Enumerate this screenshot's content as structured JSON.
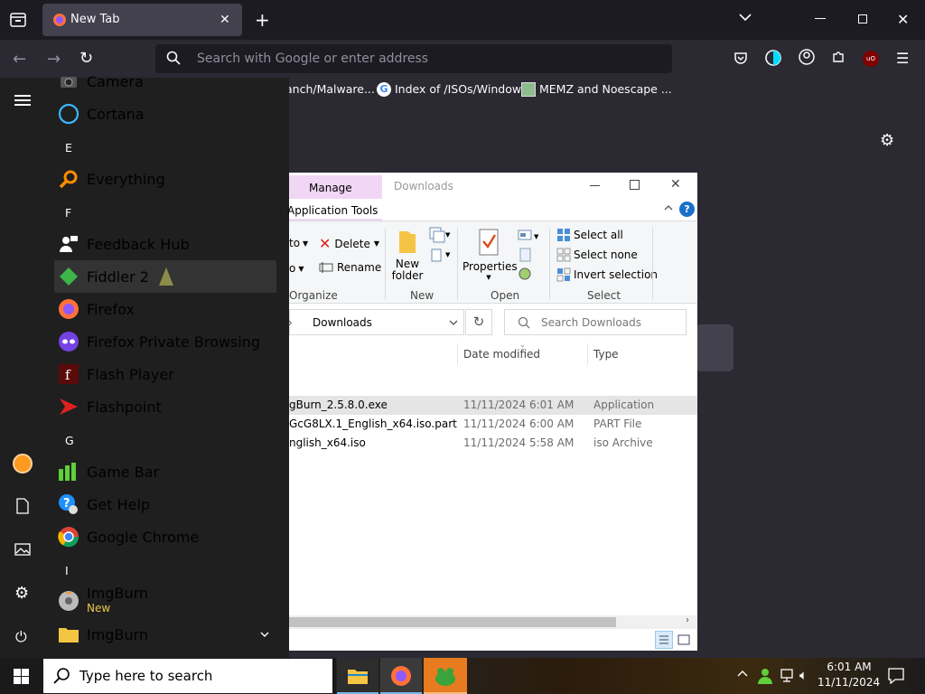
{
  "browser": {
    "tab_title": "New Tab",
    "address_placeholder": "Search with Google or enter address",
    "bookmarks": [
      "anch/Malware...",
      "Index of /ISOs/Windows",
      "MEMZ and Noescape ..."
    ]
  },
  "start_menu": {
    "apps": [
      {
        "label": "Camera"
      },
      {
        "label": "Cortana"
      },
      {
        "label": "Everything"
      },
      {
        "label": "Feedback Hub"
      },
      {
        "label": "Fiddler 2"
      },
      {
        "label": "Firefox"
      },
      {
        "label": "Firefox Private Browsing"
      },
      {
        "label": "Flash Player"
      },
      {
        "label": "Flashpoint"
      },
      {
        "label": "Game Bar"
      },
      {
        "label": "Get Help"
      },
      {
        "label": "Google Chrome"
      },
      {
        "label": "ImgBurn",
        "badge": "New"
      },
      {
        "label": "ImgBurn"
      }
    ],
    "letters": [
      "E",
      "F",
      "G",
      "I"
    ]
  },
  "explorer": {
    "tab_manage": "Manage",
    "title": "Downloads",
    "tab_app_tools": "Application Tools",
    "ribbon": {
      "copy_to": "to",
      "move_to": "o",
      "delete": "Delete",
      "rename": "Rename",
      "group_organize": "Organize",
      "new_folder": "New folder",
      "group_new": "New",
      "properties": "Properties",
      "group_open": "Open",
      "select_all": "Select all",
      "select_none": "Select none",
      "invert_selection": "Invert selection",
      "group_select": "Select"
    },
    "breadcrumb": "Downloads",
    "search_placeholder": "Search Downloads",
    "columns": {
      "date": "Date modified",
      "type": "Type"
    },
    "files": [
      {
        "name": "gBurn_2.5.8.0.exe",
        "date": "11/11/2024 6:01 AM",
        "type": "Application"
      },
      {
        "name": "GcG8LX.1_English_x64.iso.part",
        "date": "11/11/2024 6:00 AM",
        "type": "PART File"
      },
      {
        "name": "nglish_x64.iso",
        "date": "11/11/2024 5:58 AM",
        "type": "iso Archive"
      }
    ]
  },
  "taskbar": {
    "search_placeholder": "Type here to search",
    "time": "6:01 AM",
    "date": "11/11/2024"
  }
}
